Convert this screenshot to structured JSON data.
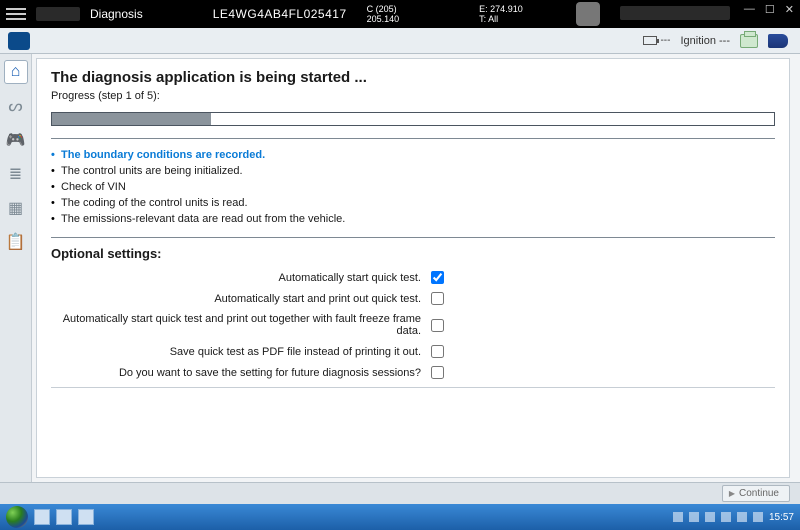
{
  "titlebar": {
    "app_name": "Diagnosis",
    "vin": "LE4WG4AB4FL025417",
    "meta_left_top": "C (205)",
    "meta_left_bottom": "205.140",
    "meta_right_top": "E: 274.910",
    "meta_right_bottom": "T: All",
    "win_min": "—",
    "win_max": "☐",
    "win_close": "✕"
  },
  "toolbar2": {
    "battery_label": "---",
    "ignition_label": "Ignition ---"
  },
  "sidebar": {
    "items": [
      {
        "name": "home-icon",
        "glyph": "⌂",
        "active": true
      },
      {
        "name": "stethoscope-icon",
        "glyph": "ᔕ"
      },
      {
        "name": "gamepad-icon",
        "glyph": "🎮"
      },
      {
        "name": "list-icon",
        "glyph": "≣"
      },
      {
        "name": "grid-icon",
        "glyph": "▦"
      },
      {
        "name": "report-icon",
        "glyph": "📋"
      }
    ]
  },
  "main": {
    "heading": "The diagnosis application is being started ...",
    "subtitle": "Progress (step 1 of 5):",
    "progress_percent": 22,
    "steps": [
      {
        "text": "The boundary conditions are recorded.",
        "active": true
      },
      {
        "text": "The control units are being initialized.",
        "active": false
      },
      {
        "text": "Check of VIN",
        "active": false
      },
      {
        "text": "The coding of the control units is read.",
        "active": false
      },
      {
        "text": "The emissions-relevant data are read out from the vehicle.",
        "active": false
      }
    ],
    "optional_heading": "Optional settings:",
    "options": [
      {
        "label": "Automatically start quick test.",
        "checked": true
      },
      {
        "label": "Automatically start and print out quick test.",
        "checked": false
      },
      {
        "label": "Automatically start quick test and print out together with fault freeze frame data.",
        "checked": false
      },
      {
        "label": "Save quick test as PDF file instead of printing it out.",
        "checked": false
      },
      {
        "label": "Do you want to save the setting for future diagnosis sessions?",
        "checked": false
      }
    ]
  },
  "buttonbar": {
    "continue_label": "Continue"
  },
  "taskbar": {
    "time": "15:57"
  }
}
